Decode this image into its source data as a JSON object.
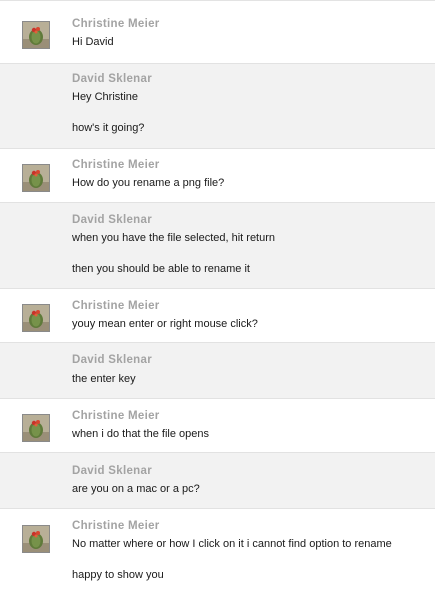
{
  "conversation": {
    "avatar_icon": "cactus-profile-photo",
    "messages": [
      {
        "sender": "Christine Meier",
        "lines": [
          "Hi David"
        ]
      },
      {
        "sender": "David Sklenar",
        "lines": [
          "Hey Christine",
          "how's it going?"
        ]
      },
      {
        "sender": "Christine Meier",
        "lines": [
          "How do you rename a png file?"
        ]
      },
      {
        "sender": "David Sklenar",
        "lines": [
          "when you have the file selected, hit return",
          "then you should be able to rename it"
        ]
      },
      {
        "sender": "Christine Meier",
        "lines": [
          "youy mean enter or right mouse click?"
        ]
      },
      {
        "sender": "David Sklenar",
        "lines": [
          "the enter key"
        ]
      },
      {
        "sender": "Christine Meier",
        "lines": [
          "when i do that the file opens"
        ]
      },
      {
        "sender": "David Sklenar",
        "lines": [
          "are you on a mac or a pc?"
        ]
      },
      {
        "sender": "Christine Meier",
        "lines": [
          "No matter where or how I click on it i cannot find option to rename",
          "happy to show you"
        ]
      }
    ]
  }
}
